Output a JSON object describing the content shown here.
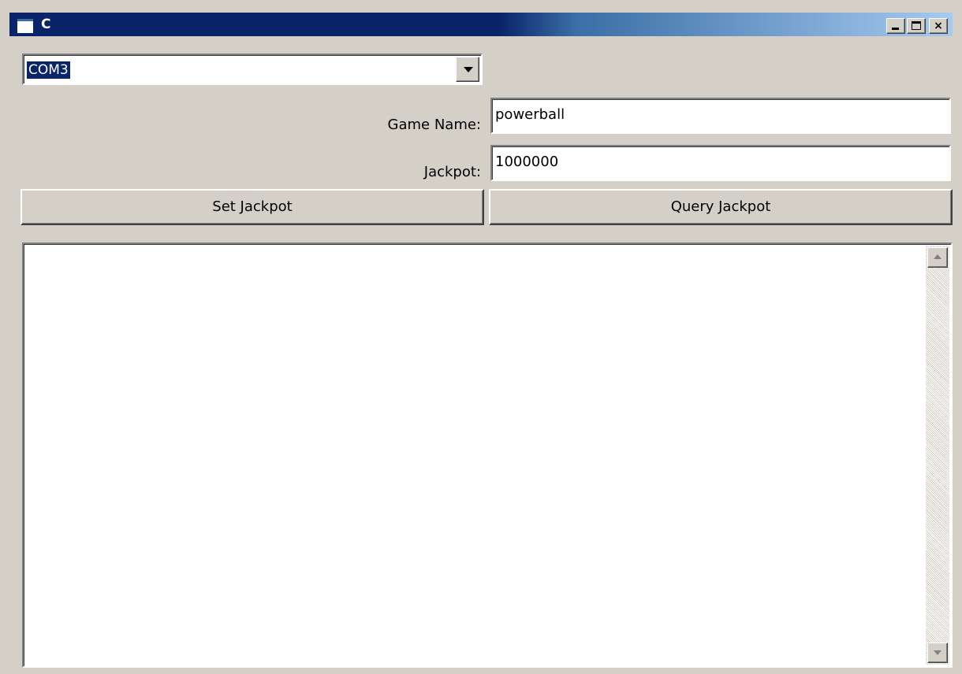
{
  "window": {
    "title": "C",
    "minimize_label": "_",
    "maximize_label": "",
    "close_label": "×"
  },
  "port_select": {
    "value": "COM3"
  },
  "form": {
    "game_name_label": "Game Name:",
    "game_name_value": "powerball",
    "jackpot_label": "Jackpot:",
    "jackpot_value": "1000000"
  },
  "buttons": {
    "set_jackpot": "Set Jackpot",
    "query_jackpot": "Query Jackpot"
  },
  "output": {
    "text": ""
  },
  "icons": {
    "window": "window-icon",
    "minimize": "minimize-icon",
    "maximize": "maximize-icon",
    "close": "close-icon",
    "dropdown": "chevron-down-icon",
    "scroll_up": "scroll-up-icon",
    "scroll_down": "scroll-down-icon"
  },
  "colors": {
    "face": "#d4d0c8",
    "title_active": "#0a246a",
    "title_gradient_end": "#a6caf0",
    "selection": "#0a246a",
    "field_bg": "#ffffff"
  }
}
